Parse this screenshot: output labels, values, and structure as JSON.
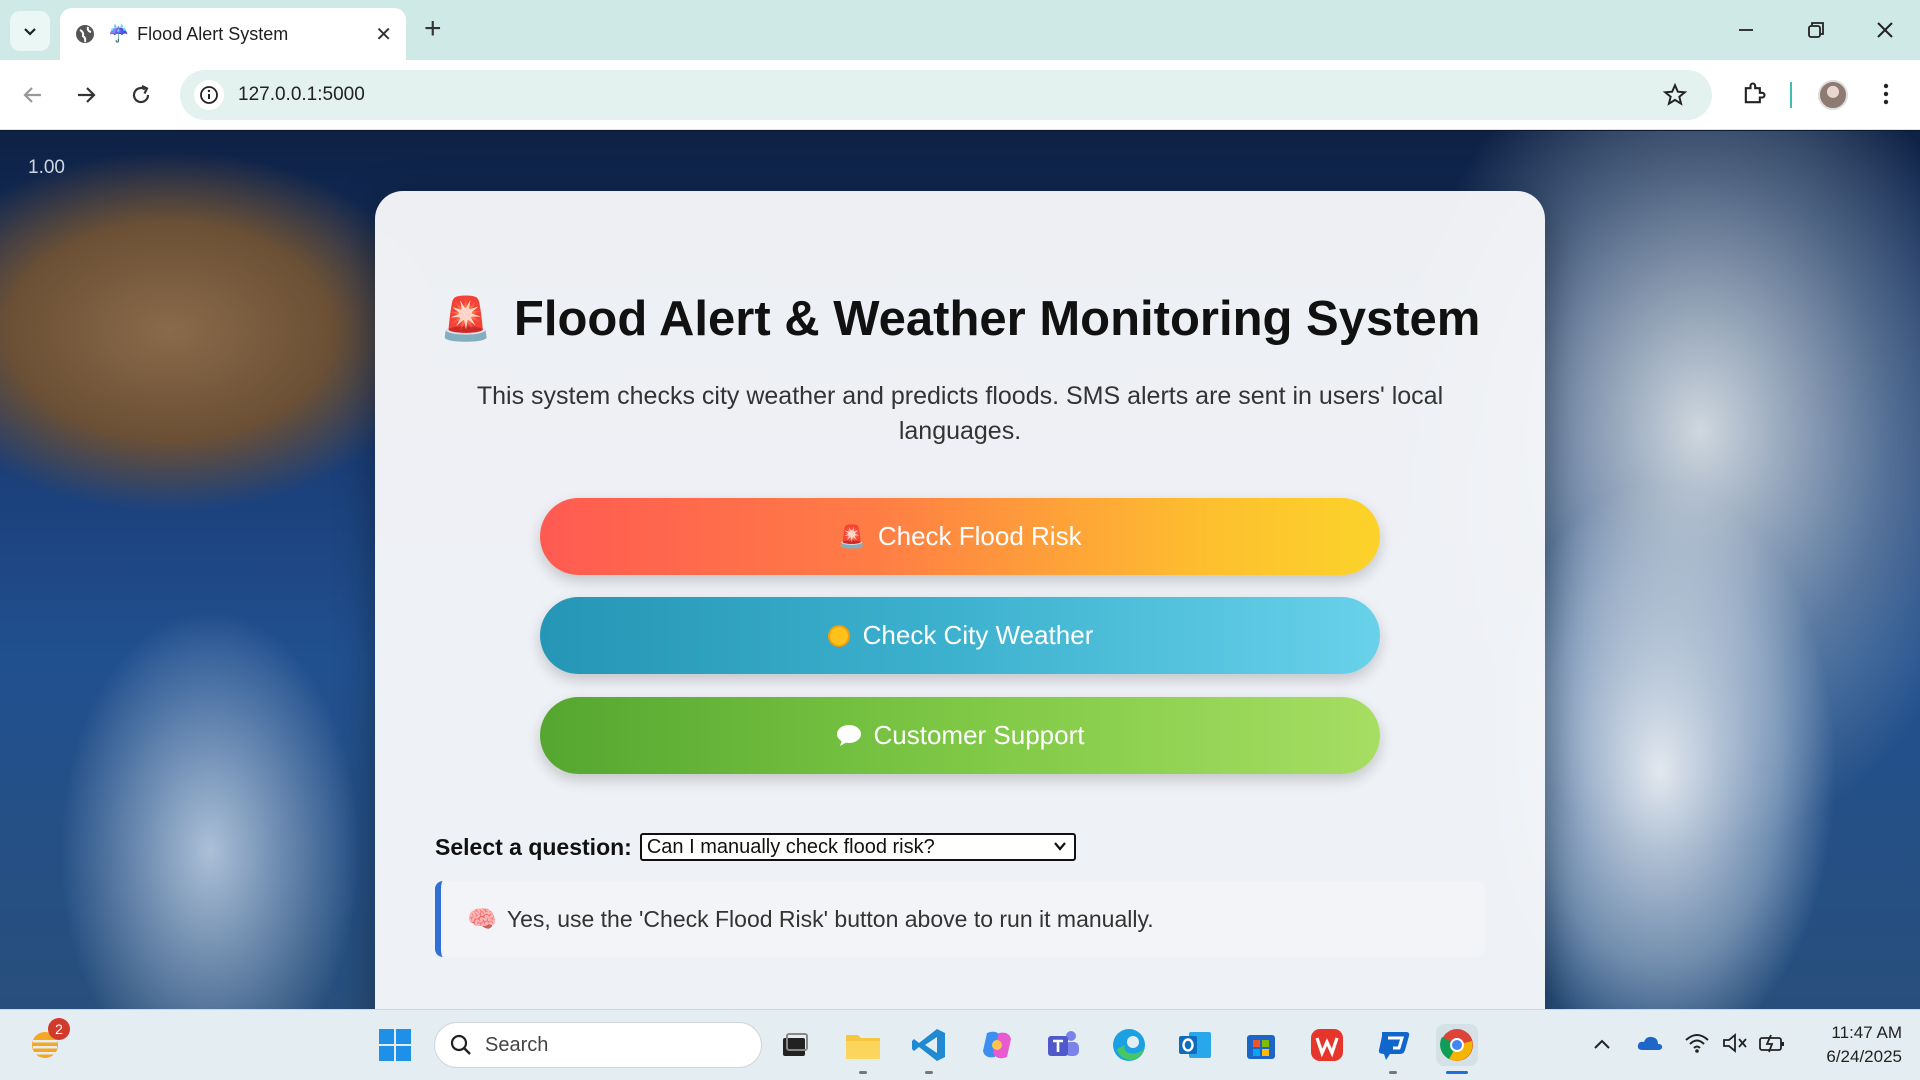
{
  "browser": {
    "tab_title": "Flood Alert System",
    "url": "127.0.0.1:5000"
  },
  "page": {
    "zoom_readout": "1.00",
    "title": "Flood Alert & Weather Monitoring System",
    "description": "This system checks city weather and predicts floods. SMS alerts are sent in users' local languages.",
    "buttons": {
      "flood": "Check Flood Risk",
      "weather": "Check City Weather",
      "support": "Customer Support"
    },
    "question_label": "Select a question:",
    "question_selected": "Can I manually check flood risk?",
    "answer": "Yes, use the 'Check Flood Risk' button above to run it manually."
  },
  "taskbar": {
    "search_placeholder": "Search",
    "notification_count": "2",
    "time": "11:47 AM",
    "date": "6/24/2025"
  },
  "colors": {
    "flood_gradient": [
      "#ff5a52",
      "#fcd32a"
    ],
    "weather_gradient": [
      "#2596b5",
      "#69d1ea"
    ],
    "support_gradient": [
      "#55a630",
      "#a6de62"
    ],
    "answer_accent": "#2f6fd6"
  },
  "icons": [
    "tab-search-icon",
    "globe-icon",
    "rain-favicon-icon",
    "close-icon",
    "plus-icon",
    "minimize-icon",
    "restore-icon",
    "window-close-icon",
    "back-arrow-icon",
    "forward-arrow-icon",
    "reload-icon",
    "site-info-icon",
    "bookmark-star-icon",
    "extensions-icon",
    "profile-avatar",
    "menu-kebab-icon",
    "siren-icon",
    "sun-icon",
    "speech-bubble-icon",
    "brain-icon",
    "chevron-down-icon",
    "windows-start-icon",
    "search-icon",
    "weather-widget-icon"
  ]
}
